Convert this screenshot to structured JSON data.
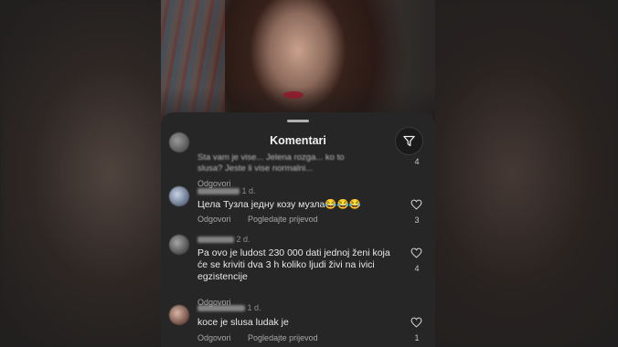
{
  "sheet": {
    "title": "Komentari"
  },
  "comments": [
    {
      "text": "Sta vam je vise... Jelena rozga... ko to slusa? Jeste li vise normalni...",
      "reply_label": "Odgovori",
      "like_count": "4"
    },
    {
      "time": "1 d.",
      "text": "Цела Тузла једну козу музла😂😂😂",
      "reply_label": "Odgovori",
      "translate_label": "Pogledajte prijevod",
      "like_count": "3"
    },
    {
      "time": "2 d.",
      "text": "Pa ovo je ludost 230 000 dati jednoj ženi koja će se kriviti dva 3 h koliko ljudi živi na ivici egzistencije",
      "reply_label": "Odgovori",
      "like_count": "4"
    },
    {
      "time": "1 d.",
      "text": "koce je slusa ludak je",
      "reply_label": "Odgovori",
      "translate_label": "Pogledajte prijevod",
      "like_count": "1"
    }
  ],
  "colors": {
    "sheet_bg": "#262626",
    "text": "#e9e9e9",
    "secondary": "#8e8e8e"
  },
  "icons": {
    "filter": "filter-send-icon",
    "like": "heart-icon"
  }
}
